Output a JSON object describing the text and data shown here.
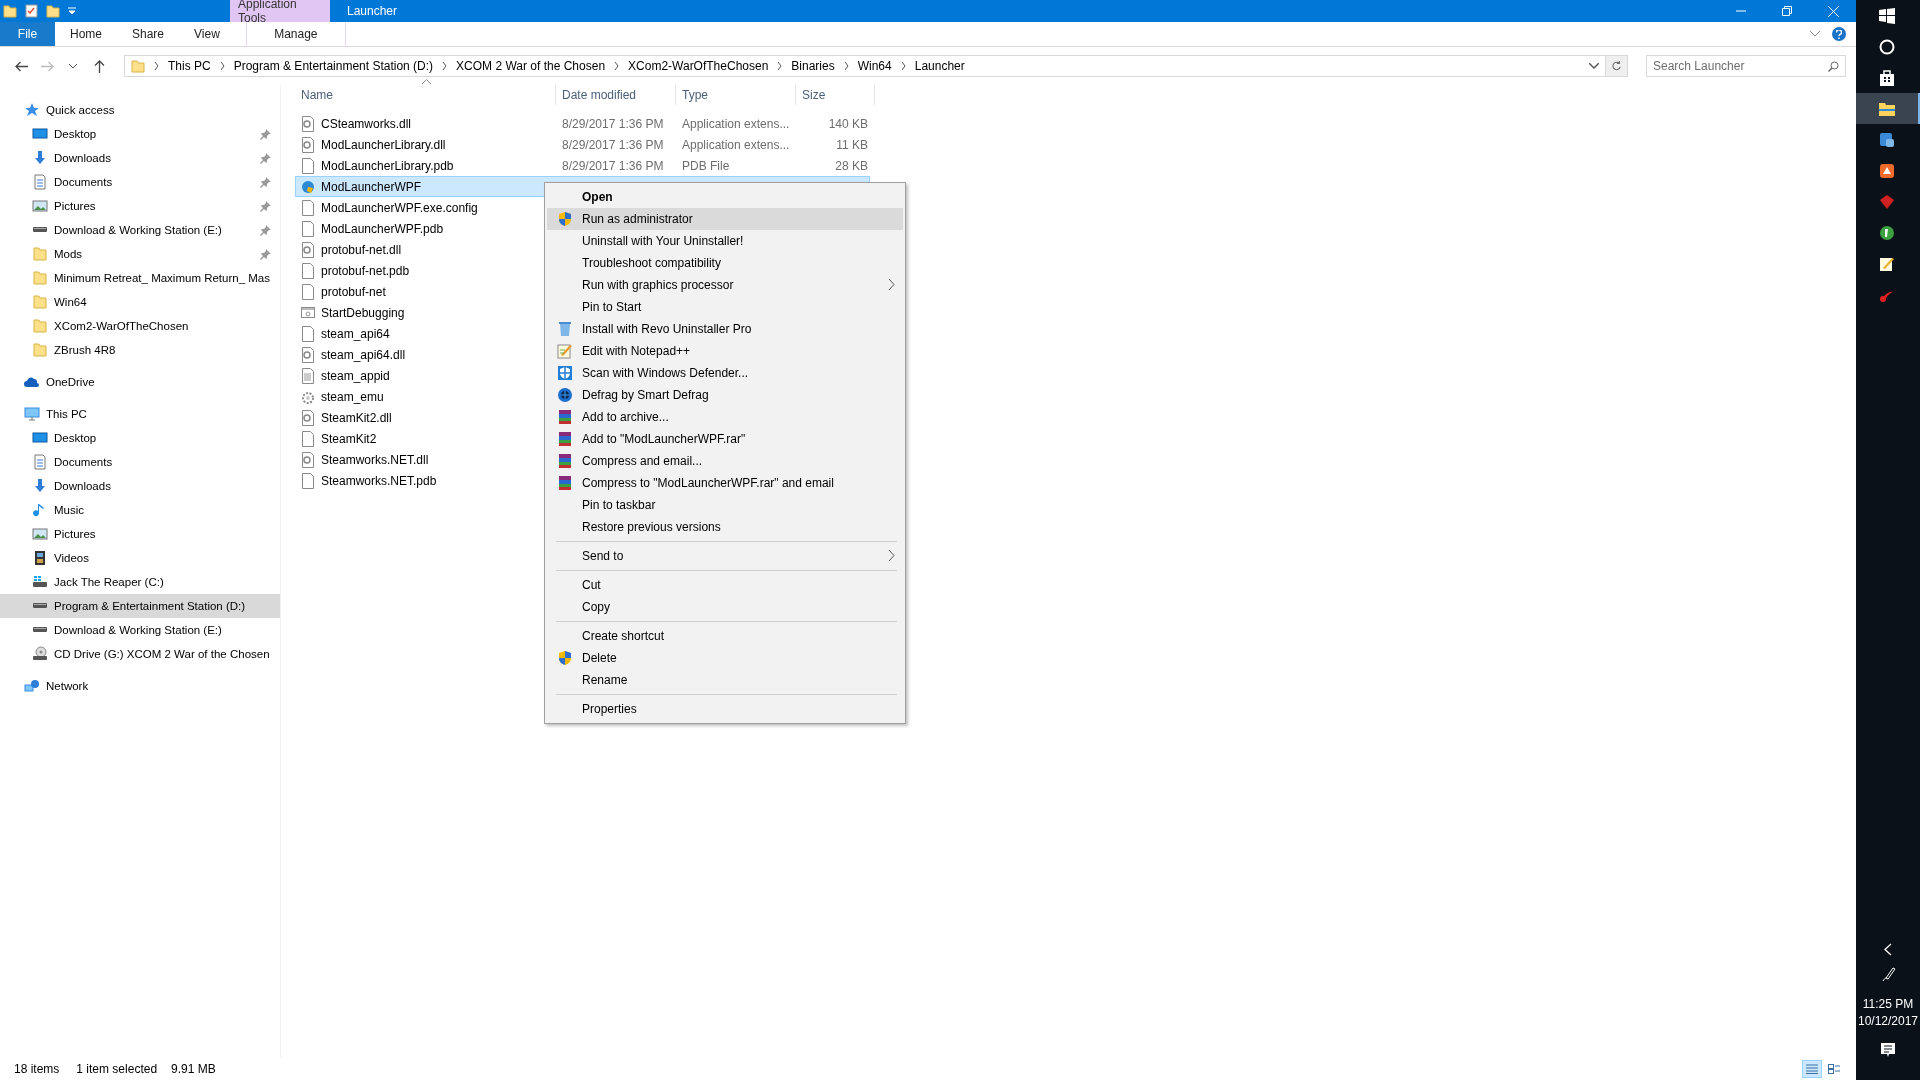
{
  "title_bar": {
    "contextual_tab": "Application Tools",
    "title": "Launcher"
  },
  "ribbon_tabs": [
    {
      "label": "File",
      "kind": "file"
    },
    {
      "label": "Home",
      "kind": "tab"
    },
    {
      "label": "Share",
      "kind": "tab"
    },
    {
      "label": "View",
      "kind": "tab"
    },
    {
      "label": "Manage",
      "kind": "contextual"
    }
  ],
  "address": {
    "crumbs": [
      "This PC",
      "Program & Entertainment Station (D:)",
      "XCOM 2 War of the Chosen",
      "XCom2-WarOfTheChosen",
      "Binaries",
      "Win64",
      "Launcher"
    ],
    "search": {
      "placeholder": "Search Launcher"
    }
  },
  "nav": [
    {
      "label": "Quick access",
      "kind": "star",
      "selected": false,
      "children": [
        {
          "label": "Desktop",
          "kind": "desktop",
          "pinned": true,
          "selected": false
        },
        {
          "label": "Downloads",
          "kind": "downloads",
          "pinned": true,
          "selected": false
        },
        {
          "label": "Documents",
          "kind": "documents",
          "pinned": true,
          "selected": false
        },
        {
          "label": "Pictures",
          "kind": "pictures",
          "pinned": true,
          "selected": false
        },
        {
          "label": "Download & Working Station (E:)",
          "kind": "drive",
          "pinned": true,
          "selected": false
        },
        {
          "label": "Mods",
          "kind": "folder",
          "pinned": true,
          "selected": false
        },
        {
          "label": "Minimum Retreat_ Maximum Return_ Mas",
          "kind": "folder",
          "pinned": false,
          "selected": false
        },
        {
          "label": "Win64",
          "kind": "folder",
          "pinned": false,
          "selected": false
        },
        {
          "label": "XCom2-WarOfTheChosen",
          "kind": "folder",
          "pinned": false,
          "selected": false
        },
        {
          "label": "ZBrush 4R8",
          "kind": "folder",
          "pinned": false,
          "selected": false
        }
      ]
    },
    {
      "label": "OneDrive",
      "kind": "cloud",
      "selected": false
    },
    {
      "label": "This PC",
      "kind": "pc",
      "selected": false,
      "children": [
        {
          "label": "Desktop",
          "kind": "desktop",
          "pinned": false,
          "selected": false
        },
        {
          "label": "Documents",
          "kind": "documents",
          "pinned": false,
          "selected": false
        },
        {
          "label": "Downloads",
          "kind": "downloads",
          "pinned": false,
          "selected": false
        },
        {
          "label": "Music",
          "kind": "music",
          "pinned": false,
          "selected": false
        },
        {
          "label": "Pictures",
          "kind": "pictures",
          "pinned": false,
          "selected": false
        },
        {
          "label": "Videos",
          "kind": "videos",
          "pinned": false,
          "selected": false
        },
        {
          "label": "Jack The Reaper (C:)",
          "kind": "system-drive",
          "pinned": false,
          "selected": false
        },
        {
          "label": "Program & Entertainment Station (D:)",
          "kind": "drive",
          "pinned": false,
          "selected": true
        },
        {
          "label": "Download & Working Station (E:)",
          "kind": "drive",
          "pinned": false,
          "selected": false
        },
        {
          "label": "CD Drive (G:) XCOM 2 War of the Chosen",
          "kind": "cd",
          "pinned": false,
          "selected": false
        }
      ]
    },
    {
      "label": "Network",
      "kind": "network",
      "selected": false
    }
  ],
  "columns": [
    "Name",
    "Date modified",
    "Type",
    "Size"
  ],
  "files": [
    {
      "name": "CSteamworks.dll",
      "kind": "dll",
      "date": "8/29/2017 1:36 PM",
      "type": "Application extens...",
      "size": "140 KB",
      "selected": false
    },
    {
      "name": "ModLauncherLibrary.dll",
      "kind": "dll",
      "date": "8/29/2017 1:36 PM",
      "type": "Application extens...",
      "size": "11 KB",
      "selected": false
    },
    {
      "name": "ModLauncherLibrary.pdb",
      "kind": "file",
      "date": "8/29/2017 1:36 PM",
      "type": "PDB File",
      "size": "28 KB",
      "selected": false
    },
    {
      "name": "ModLauncherWPF",
      "kind": "app",
      "selected": true
    },
    {
      "name": "ModLauncherWPF.exe.config",
      "kind": "file",
      "selected": false
    },
    {
      "name": "ModLauncherWPF.pdb",
      "kind": "file",
      "selected": false
    },
    {
      "name": "protobuf-net.dll",
      "kind": "dll",
      "selected": false
    },
    {
      "name": "protobuf-net.pdb",
      "kind": "file",
      "selected": false
    },
    {
      "name": "protobuf-net",
      "kind": "file",
      "selected": false
    },
    {
      "name": "StartDebugging",
      "kind": "exe",
      "selected": false
    },
    {
      "name": "steam_api64",
      "kind": "file",
      "selected": false
    },
    {
      "name": "steam_api64.dll",
      "kind": "dll",
      "selected": false
    },
    {
      "name": "steam_appid",
      "kind": "text",
      "selected": false
    },
    {
      "name": "steam_emu",
      "kind": "settings",
      "selected": false
    },
    {
      "name": "SteamKit2.dll",
      "kind": "dll",
      "selected": false
    },
    {
      "name": "SteamKit2",
      "kind": "file",
      "selected": false
    },
    {
      "name": "Steamworks.NET.dll",
      "kind": "dll",
      "selected": false
    },
    {
      "name": "Steamworks.NET.pdb",
      "kind": "file",
      "selected": false
    }
  ],
  "context_menu": [
    {
      "kind": "item",
      "label": "Open",
      "default": true,
      "selected": false
    },
    {
      "kind": "shield",
      "label": "Run as administrator",
      "selected": true
    },
    {
      "kind": "item",
      "label": "Uninstall with Your Uninstaller!",
      "selected": false
    },
    {
      "kind": "item",
      "label": "Troubleshoot compatibility",
      "selected": false
    },
    {
      "kind": "item",
      "label": "Run with graphics processor",
      "submenu": true,
      "selected": false
    },
    {
      "kind": "item",
      "label": "Pin to Start",
      "selected": false
    },
    {
      "kind": "revo",
      "label": "Install with Revo Uninstaller Pro",
      "selected": false
    },
    {
      "kind": "notepad",
      "label": "Edit with Notepad++",
      "selected": false
    },
    {
      "kind": "defender",
      "label": "Scan with Windows Defender...",
      "selected": false
    },
    {
      "kind": "defrag",
      "label": "Defrag by Smart Defrag",
      "selected": false
    },
    {
      "kind": "winrar",
      "label": "Add to archive...",
      "selected": false
    },
    {
      "kind": "winrar",
      "label": "Add to \"ModLauncherWPF.rar\"",
      "selected": false
    },
    {
      "kind": "winrar",
      "label": "Compress and email...",
      "selected": false
    },
    {
      "kind": "winrar",
      "label": "Compress to \"ModLauncherWPF.rar\" and email",
      "selected": false
    },
    {
      "kind": "item",
      "label": "Pin to taskbar",
      "selected": false
    },
    {
      "kind": "item",
      "label": "Restore previous versions",
      "selected": false
    },
    {
      "kind": "separator"
    },
    {
      "kind": "item",
      "label": "Send to",
      "submenu": true,
      "selected": false
    },
    {
      "kind": "separator"
    },
    {
      "kind": "item",
      "label": "Cut",
      "selected": false
    },
    {
      "kind": "item",
      "label": "Copy",
      "selected": false
    },
    {
      "kind": "separator"
    },
    {
      "kind": "item",
      "label": "Create shortcut",
      "selected": false
    },
    {
      "kind": "shield",
      "label": "Delete",
      "selected": false
    },
    {
      "kind": "item",
      "label": "Rename",
      "selected": false
    },
    {
      "kind": "separator"
    },
    {
      "kind": "item",
      "label": "Properties",
      "selected": false
    }
  ],
  "status_bar": {
    "count": "18 items",
    "selection": "1 item selected",
    "size": "9.91 MB"
  },
  "view_buttons": [
    {
      "kind": "details",
      "selected": true
    },
    {
      "kind": "tiles",
      "selected": false
    }
  ],
  "taskbar": {
    "apps": [
      {
        "kind": "start",
        "selected": false
      },
      {
        "kind": "cortana",
        "selected": false
      },
      {
        "kind": "store",
        "selected": false
      },
      {
        "kind": "explorer",
        "selected": true
      },
      {
        "kind": "blue-app",
        "selected": false
      },
      {
        "kind": "orange-app",
        "selected": false
      },
      {
        "kind": "red-app",
        "selected": false
      },
      {
        "kind": "green-app",
        "selected": false
      },
      {
        "kind": "notes-app",
        "selected": false
      },
      {
        "kind": "pdf-app",
        "selected": false
      }
    ],
    "time": "11:25 PM",
    "date": "10/12/2017"
  }
}
